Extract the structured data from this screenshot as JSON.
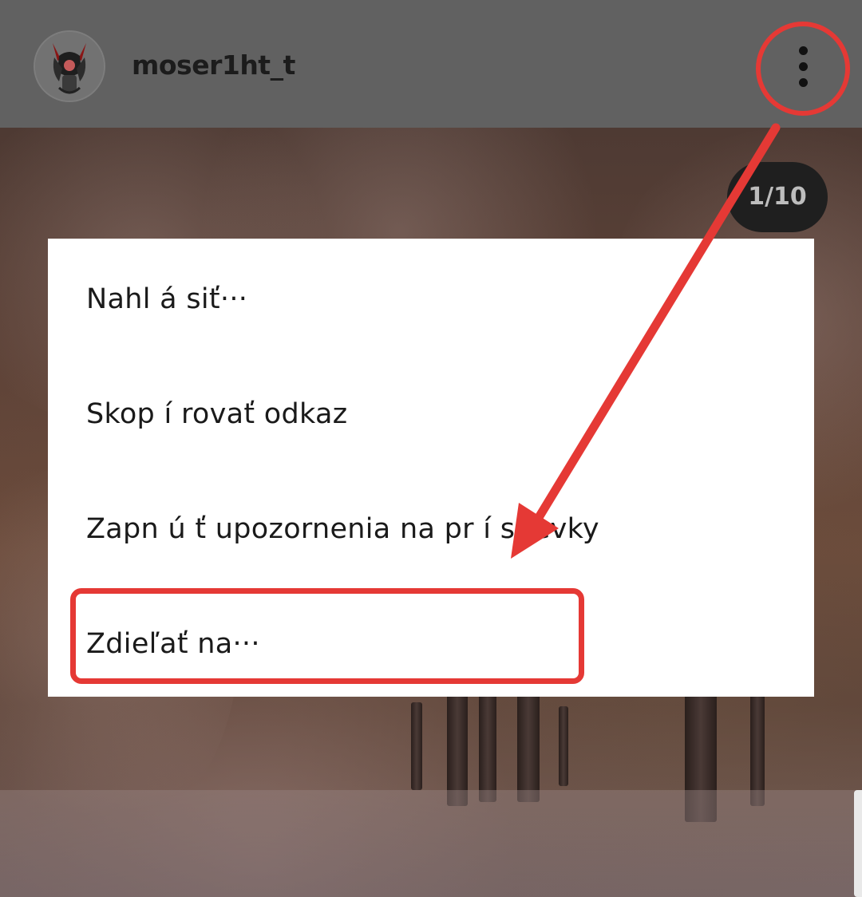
{
  "header": {
    "username": "moser1ht_t",
    "avatar_icon": "devil-avatar-icon",
    "more_icon": "vertical-dots-icon"
  },
  "post": {
    "counter": "1/10"
  },
  "menu": {
    "items": [
      {
        "label": "Nahl á siť···"
      },
      {
        "label": "Skop í rovať odkaz"
      },
      {
        "label": "Zapn ú ť upozornenia na pr í spevky"
      },
      {
        "label": "Zdieľať na···"
      }
    ]
  },
  "annotation": {
    "color": "#e53935"
  }
}
